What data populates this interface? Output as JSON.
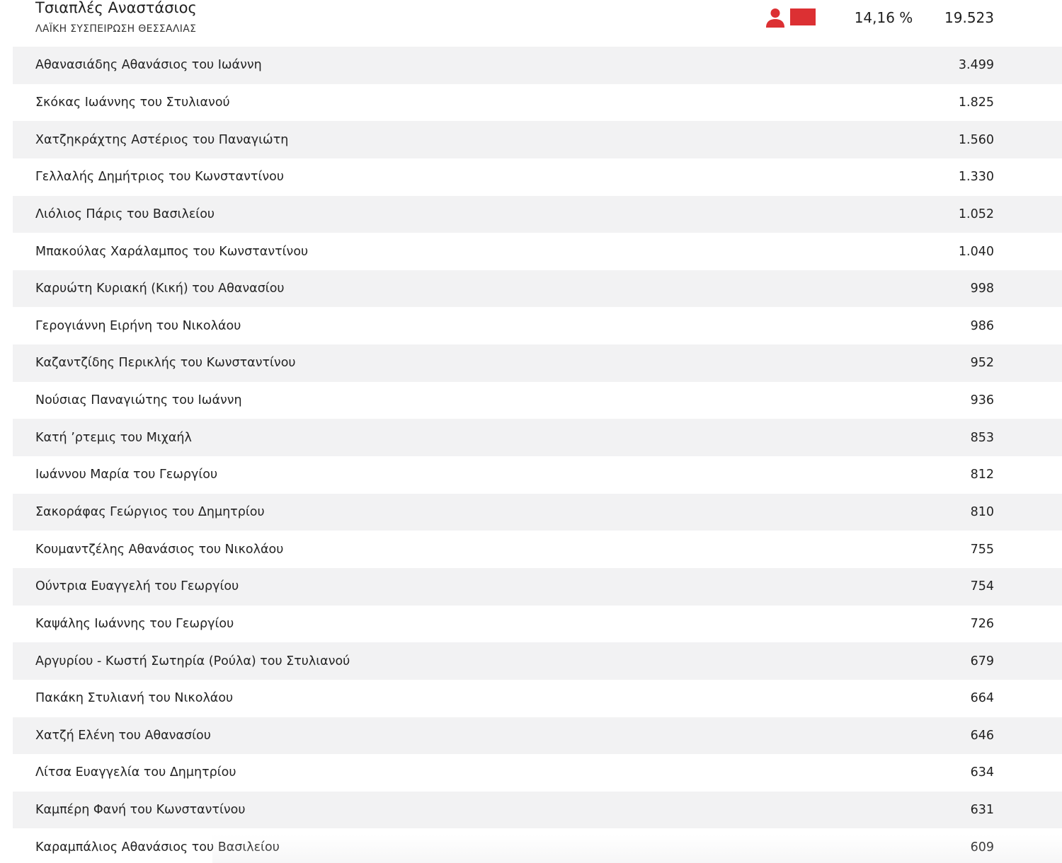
{
  "header": {
    "candidate_name": "Τσιαπλές Αναστάσιος",
    "party_name": "ΛΑΪΚΗ ΣΥΣΠΕΙΡΩΣΗ ΘΕΣΣΑΛΙΑΣ",
    "person_icon": "person-icon",
    "party_color": "#dc3033",
    "percent": "14,16 %",
    "total_votes": "19.523"
  },
  "candidates": [
    {
      "name": "Αθανασιάδης Αθανάσιος του Ιωάννη",
      "votes": "3.499"
    },
    {
      "name": "Σκόκας Ιωάννης του Στυλιανού",
      "votes": "1.825"
    },
    {
      "name": "Χατζηκράχτης Αστέριος του Παναγιώτη",
      "votes": "1.560"
    },
    {
      "name": "Γελλαλής Δημήτριος του Κωνσταντίνου",
      "votes": "1.330"
    },
    {
      "name": "Λιόλιος Πάρις του Βασιλείου",
      "votes": "1.052"
    },
    {
      "name": "Μπακούλας Χαράλαμπος του Κωνσταντίνου",
      "votes": "1.040"
    },
    {
      "name": "Καρυώτη Κυριακή (Κική) του Αθανασίου",
      "votes": "998"
    },
    {
      "name": "Γερογιάννη Ειρήνη του Νικολάου",
      "votes": "986"
    },
    {
      "name": "Καζαντζίδης Περικλής του Κωνσταντίνου",
      "votes": "952"
    },
    {
      "name": "Νούσιας Παναγιώτης του Ιωάννη",
      "votes": "936"
    },
    {
      "name": "Κατή ’ρτεμις του Μιχαήλ",
      "votes": "853"
    },
    {
      "name": "Ιωάννου Μαρία του Γεωργίου",
      "votes": "812"
    },
    {
      "name": "Σακοράφας Γεώργιος του Δημητρίου",
      "votes": "810"
    },
    {
      "name": "Κουμαντζέλης Αθανάσιος του Νικολάου",
      "votes": "755"
    },
    {
      "name": "Ούντρια Ευαγγελή του Γεωργίου",
      "votes": "754"
    },
    {
      "name": "Καψάλης Ιωάννης του Γεωργίου",
      "votes": "726"
    },
    {
      "name": "Αργυρίου - Κωστή Σωτηρία (Ρούλα) του Στυλιανού",
      "votes": "679"
    },
    {
      "name": "Πακάκη Στυλιανή του Νικολάου",
      "votes": "664"
    },
    {
      "name": "Χατζή Ελένη του Αθανασίου",
      "votes": "646"
    },
    {
      "name": "Λίτσα Ευαγγελία του Δημητρίου",
      "votes": "634"
    },
    {
      "name": "Καμπέρη Φανή του Κωνσταντίνου",
      "votes": "631"
    },
    {
      "name": "Καραμπάλιος Αθανάσιος του Βασιλείου",
      "votes": "609"
    }
  ]
}
